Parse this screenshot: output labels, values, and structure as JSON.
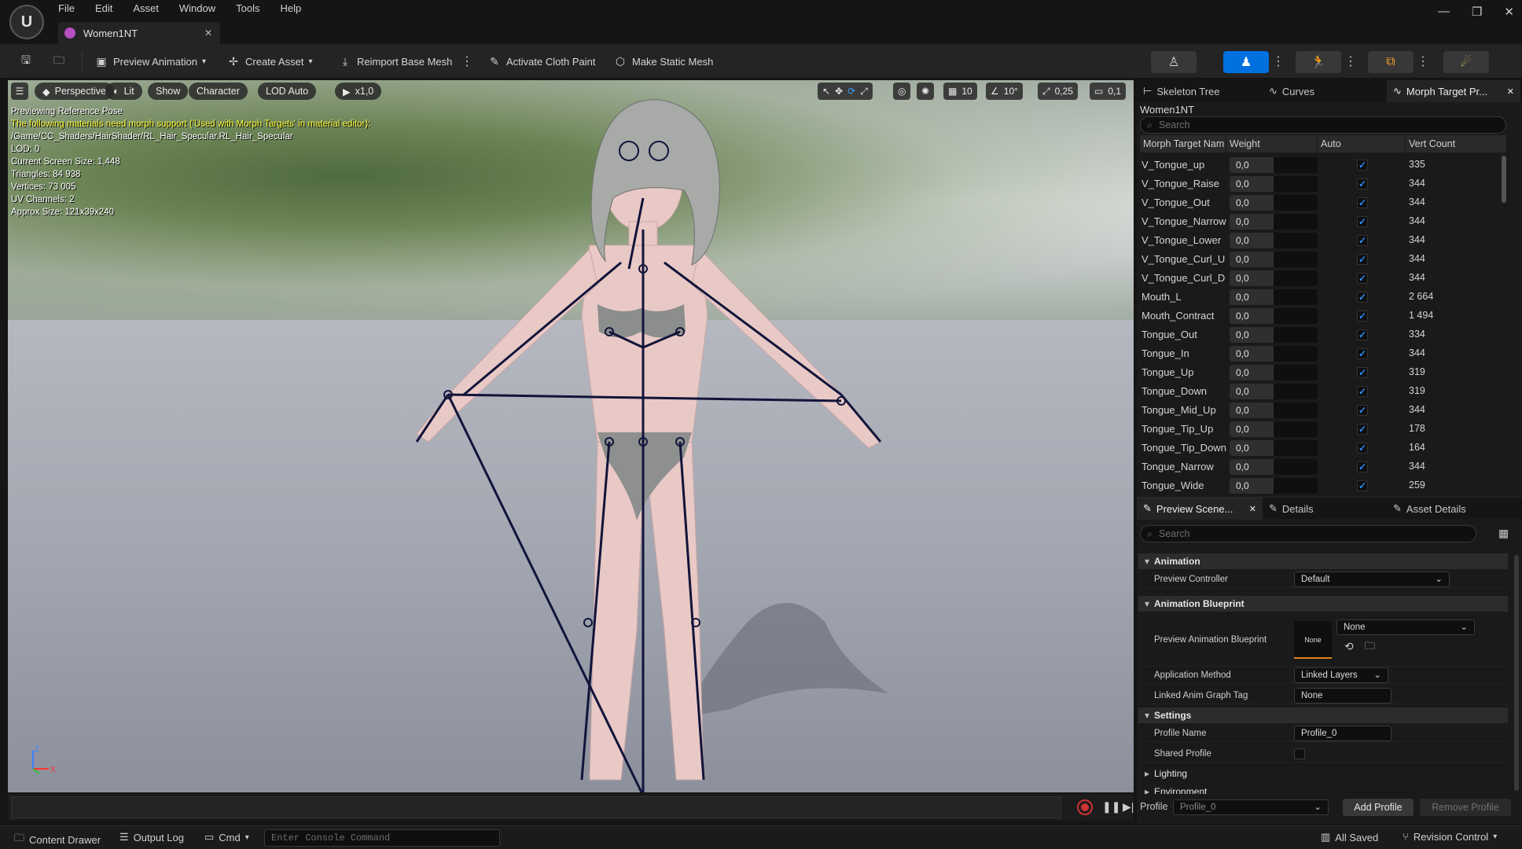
{
  "menu": [
    "File",
    "Edit",
    "Asset",
    "Window",
    "Tools",
    "Help"
  ],
  "document_tab": "Women1NT",
  "toolbar": {
    "preview_animation": "Preview Animation",
    "create_asset": "Create Asset",
    "reimport_base_mesh": "Reimport Base Mesh",
    "activate_cloth_paint": "Activate Cloth Paint",
    "make_static_mesh": "Make Static Mesh"
  },
  "viewport": {
    "perspective": "Perspective",
    "lit": "Lit",
    "show": "Show",
    "character": "Character",
    "lod": "LOD Auto",
    "play_rate": "x1,0",
    "grid_snap": "10",
    "rot_snap": "10°",
    "scale_snap": "0,25",
    "camera_speed": "0,1",
    "info_lines": [
      {
        "text": "Previewing Reference Pose",
        "warn": false
      },
      {
        "text": "The following materials need morph support ('Used with Morph Targets' in material editor):",
        "warn": true
      },
      {
        "text": "/Game/CC_Shaders/HairShader/RL_Hair_Specular.RL_Hair_Specular",
        "warn": false
      },
      {
        "text": "LOD: 0",
        "warn": false
      },
      {
        "text": "Current Screen Size: 1,448",
        "warn": false
      },
      {
        "text": "Triangles: 84 938",
        "warn": false
      },
      {
        "text": "Vertices: 73 005",
        "warn": false
      },
      {
        "text": "UV Channels: 2",
        "warn": false
      },
      {
        "text": "Approx Size: 121x39x240",
        "warn": false
      }
    ]
  },
  "statusbar": {
    "content_drawer": "Content Drawer",
    "output_log": "Output Log",
    "cmd": "Cmd",
    "console_placeholder": "Enter Console Command",
    "all_saved": "All Saved",
    "revision_control": "Revision Control"
  },
  "right_tabs": {
    "skeleton_tree": "Skeleton Tree",
    "curves": "Curves",
    "morph_target": "Morph Target Pr..."
  },
  "morph": {
    "asset_name": "Women1NT",
    "search_placeholder": "Search",
    "col_name": "Morph Target Nam",
    "col_weight": "Weight",
    "col_auto": "Auto",
    "col_vert": "Vert Count",
    "rows": [
      {
        "name": "V_Tongue_up",
        "weight": "0,0",
        "vert": "335"
      },
      {
        "name": "V_Tongue_Raise",
        "weight": "0,0",
        "vert": "344"
      },
      {
        "name": "V_Tongue_Out",
        "weight": "0,0",
        "vert": "344"
      },
      {
        "name": "V_Tongue_Narrow",
        "weight": "0,0",
        "vert": "344"
      },
      {
        "name": "V_Tongue_Lower",
        "weight": "0,0",
        "vert": "344"
      },
      {
        "name": "V_Tongue_Curl_U",
        "weight": "0,0",
        "vert": "344"
      },
      {
        "name": "V_Tongue_Curl_D",
        "weight": "0,0",
        "vert": "344"
      },
      {
        "name": "Mouth_L",
        "weight": "0,0",
        "vert": "2 664"
      },
      {
        "name": "Mouth_Contract",
        "weight": "0,0",
        "vert": "1 494"
      },
      {
        "name": "Tongue_Out",
        "weight": "0,0",
        "vert": "334"
      },
      {
        "name": "Tongue_In",
        "weight": "0,0",
        "vert": "344"
      },
      {
        "name": "Tongue_Up",
        "weight": "0,0",
        "vert": "319"
      },
      {
        "name": "Tongue_Down",
        "weight": "0,0",
        "vert": "319"
      },
      {
        "name": "Tongue_Mid_Up",
        "weight": "0,0",
        "vert": "344"
      },
      {
        "name": "Tongue_Tip_Up",
        "weight": "0,0",
        "vert": "178"
      },
      {
        "name": "Tongue_Tip_Down",
        "weight": "0,0",
        "vert": "164"
      },
      {
        "name": "Tongue_Narrow",
        "weight": "0,0",
        "vert": "344"
      },
      {
        "name": "Tongue_Wide",
        "weight": "0,0",
        "vert": "259"
      }
    ]
  },
  "lower_tabs": {
    "preview_scene": "Preview Scene...",
    "details": "Details",
    "asset_details": "Asset Details"
  },
  "preview_scene": {
    "search_placeholder": "Search",
    "animation_section": "Animation",
    "preview_controller_label": "Preview Controller",
    "preview_controller_value": "Default",
    "anim_bp_section": "Animation Blueprint",
    "preview_anim_bp_label": "Preview Animation Blueprint",
    "preview_anim_bp_value": "None",
    "preview_anim_bp_thumb": "None",
    "application_method_label": "Application Method",
    "application_method_value": "Linked Layers",
    "linked_tag_label": "Linked Anim Graph Tag",
    "linked_tag_value": "None",
    "settings_section": "Settings",
    "profile_name_label": "Profile Name",
    "profile_name_value": "Profile_0",
    "shared_profile_label": "Shared Profile",
    "lighting_section": "Lighting",
    "environment_section": "Environment"
  },
  "profile_bar": {
    "label": "Profile",
    "value": "Profile_0",
    "add": "Add Profile",
    "remove": "Remove Profile"
  },
  "colors": {
    "accent": "#0070e0",
    "warn_text": "#ffff40",
    "checkbox": "#2a8cff"
  }
}
